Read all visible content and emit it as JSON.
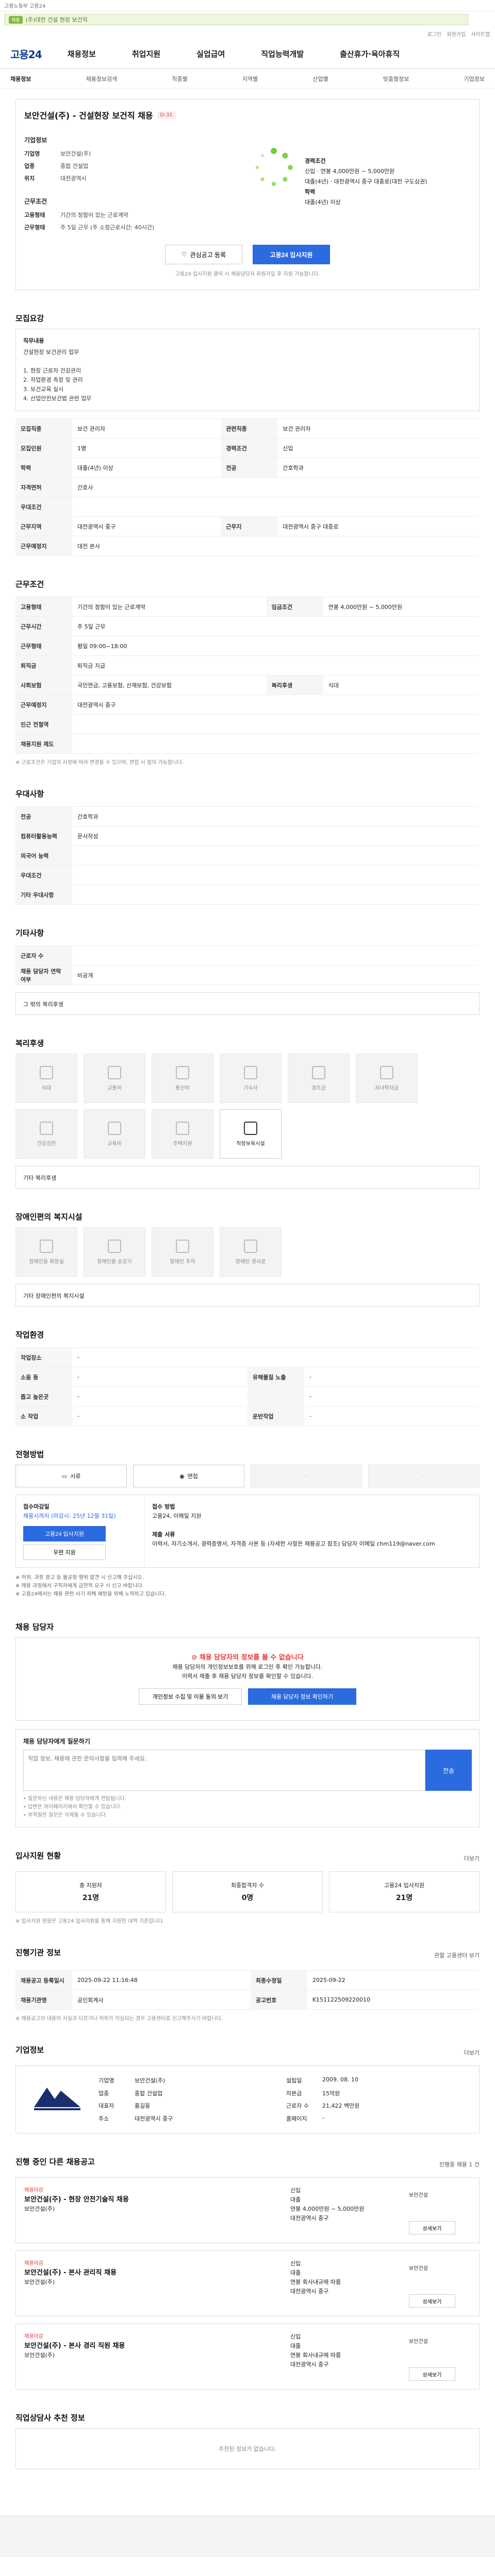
{
  "header": {
    "top_note": "고용노동부 고용24",
    "search_tag": "채용",
    "search_text": "(주)대전 건설 현장 보건직",
    "util_links": [
      "로그인",
      "회원가입",
      "사이트맵"
    ],
    "logo": "고용24",
    "menu": [
      "채용정보",
      "취업지원",
      "실업급여",
      "직업능력개발",
      "출산휴가·육아휴직"
    ]
  },
  "lnb": [
    "채용정보",
    "채용정보검색",
    "직종별",
    "지역별",
    "산업별",
    "맞춤형정보",
    "기업정보"
  ],
  "job": {
    "title": "보안건설(주) - 건설현장 보건직 채용",
    "badge": "D-31",
    "company_header": "기업정보",
    "company_rows": [
      [
        "기업명",
        "보안건설(주)"
      ],
      [
        "업종",
        "종합 건설업"
      ],
      [
        "위치",
        "대전광역시"
      ]
    ],
    "cond_header": "근무조건",
    "cond_rows": [
      [
        "고용형태",
        "기간의 정함이 있는 근로계약"
      ],
      [
        "근무형태",
        "주 5일 근무 (주 소정근로시간: 40시간)"
      ]
    ],
    "salary_header": "경력조건",
    "salary_lines": [
      "신입",
      "연봉 4,000만원 ~ 5,000만원",
      "대졸(4년)",
      "대전광역시 중구 대종로(대전 구도심권)",
      "학력",
      "대졸(4년) 이상"
    ],
    "save_btn": "관심공고 등록",
    "apply_btn": "고용24 입사지원",
    "notice": "고용24 입사지원 클릭 시 채용담당자 회원가입 후 지원 가능합니다."
  },
  "recruit": {
    "title": "모집요강",
    "desc_title": "직무내용",
    "desc": "건설현장 보건관리 업무\n\n1. 현장 근로자 건강관리\n2. 작업환경 측정 및 관리\n3. 보건교육 실시\n4. 산업안전보건법 관련 업무",
    "rows": [
      [
        "모집직종",
        "보건 관리자",
        "관련직종",
        "보건 관리자"
      ],
      [
        "모집인원",
        "1명",
        "경력조건",
        "신입"
      ],
      [
        "학력",
        "대졸(4년) 이상",
        "전공",
        "간호학과"
      ],
      [
        "자격면허",
        "간호사",
        "",
        ""
      ],
      [
        "우대조건",
        "",
        ""
      ],
      [
        "근무지역",
        "대전광역시 중구",
        "근무지",
        "대전광역시 중구 대종로"
      ],
      [
        "근무예정지",
        "대전 본사",
        "",
        ""
      ]
    ]
  },
  "conditions": {
    "title": "근무조건",
    "rows": [
      [
        "고용형태",
        "기간의 정함이 있는 근로계약",
        "임금조건",
        "연봉 4,000만원 ~ 5,000만원"
      ],
      [
        "근무시간",
        "주 5일 근무",
        "",
        ""
      ],
      [
        "근무형태",
        "평일 09:00~18:00",
        "",
        ""
      ],
      [
        "퇴직금",
        "퇴직금 지급",
        "",
        ""
      ],
      [
        "사회보험",
        "국민연금, 고용보험, 산재보험, 건강보험",
        "복리후생",
        "식대"
      ],
      [
        "근무예정지",
        "대전광역시 중구",
        "",
        ""
      ],
      [
        "인근 전철역",
        "",
        ""
      ],
      [
        "채용지원 제도",
        "",
        ""
      ]
    ],
    "hint": "※ 근로조건은 기업의 사정에 따라 변경될 수 있으며, 면접 시 협의 가능합니다."
  },
  "extras": {
    "title": "우대사항",
    "rows": [
      [
        "전공",
        "간호학과"
      ],
      [
        "컴퓨터활용능력",
        "",
        "문서작성"
      ],
      [
        "외국어 능력",
        ""
      ],
      [
        "우대조건",
        ""
      ],
      [
        "기타 우대사항",
        ""
      ]
    ]
  },
  "other": {
    "title": "기타사항",
    "rows": [
      [
        "근로자 수",
        "",
        "",
        ""
      ],
      [
        "채용 담당자 연락 여부",
        "비공개"
      ]
    ],
    "etc_label": "그 밖의 복리후생"
  },
  "welfare": {
    "title": "복리후생",
    "items": [
      "식대",
      "교통비",
      "통신비",
      "기숙사",
      "경조금",
      "자녀학자금",
      "건강검진",
      "교육비",
      "주택지원",
      "직장보육시설"
    ],
    "active_index": 9,
    "other": "기타 복리후생"
  },
  "disabled": {
    "title": "장애인편의 복지시설",
    "items": [
      "장애인용 화장실",
      "장애인용 승강기",
      "장애인 주차",
      "장애인 경사로"
    ],
    "other": "기타 장애인편의 복지시설"
  },
  "env": {
    "title": "작업환경",
    "rows": [
      [
        "작업장소",
        "-",
        "",
        ""
      ],
      [
        "소음 등",
        "-",
        "유해물질 노출",
        "-"
      ],
      [
        "좁고 높은곳",
        "-",
        "",
        "-"
      ],
      [
        "소 작업",
        "-",
        "운반작업",
        "-"
      ]
    ]
  },
  "process": {
    "title": "전형방법",
    "steps": [
      "서류",
      "면접",
      "-",
      "-"
    ],
    "apply_title": "접수마감일",
    "apply_date": "채용시까지 (마감시: 25년 12월 31일)",
    "apply_btn": "고용24 입사지원",
    "apply_btn2": "우편 지원",
    "method_title": "접수 방법",
    "method_text": "고용24, 이메일 지원",
    "docs_title": "제출 서류",
    "docs_text": "이력서, 자기소개서, 경력증명서, 자격증 사본 등 (자세한 사항은 채용공고 참조) 담당자 이메일 chm119@naver.com",
    "bullets": [
      "※ 허위, 과장 광고 등 불공정 행위 발견 시 신고해 주십시오.",
      "※ 채용 과정에서 구직자에게 금전적 요구 시 신고 바랍니다.",
      "※ 고용24에서는 채용 관련 사기 피해 예방을 위해 노력하고 있습니다."
    ]
  },
  "manager": {
    "title": "채용 담당자",
    "warn": "채용 담당자의 정보를 볼 수 없습니다",
    "text1": "채용 담당자의 개인정보보호를 위해 로그인 후 확인 가능합니다.",
    "text2": "이력서 제출 후 채용 담당자 정보를 확인할 수 있습니다.",
    "btn1": "개인정보 수집 및 이용 동의 보기",
    "btn2": "채용 담당자 정보 확인하기",
    "qa_label": "채용 담당자에게 질문하기",
    "qa_placeholder": "직업 정보, 채용에 관한 문의사항을 입력해 주세요.",
    "qa_send": "전송",
    "qa_notes": [
      "• 질문하신 내용은 채용 담당자에게 전달됩니다.",
      "• 답변은 마이페이지에서 확인할 수 있습니다.",
      "• 부적절한 질문은 삭제될 수 있습니다."
    ]
  },
  "stats": {
    "title": "입사지원 현황",
    "more": "더보기",
    "items": [
      [
        "총 지원자",
        "21명"
      ],
      [
        "최종합격자 수",
        "0명"
      ],
      [
        "고용24 입사지원",
        "21명"
      ]
    ],
    "hint": "※ 입사지원 현황은 고용24 입사지원을 통해 지원한 내역 기준입니다."
  },
  "info": {
    "title": "진행기관 정보",
    "more": "관할 고용센터 보기",
    "rows": [
      [
        "채용공고 등록일시",
        "2025-09-22 11:16:48",
        "최종수정일",
        "2025-09-22"
      ],
      [
        "채용기관명",
        "공인회계사",
        "공고번호",
        "K151122509220010"
      ]
    ],
    "hint": "※ 채용공고의 내용이 사실과 다르거나 허위가 의심되는 경우 고용센터로 신고해주시기 바랍니다."
  },
  "company": {
    "title": "기업정보",
    "more": "더보기",
    "logo": "보안건설",
    "rows1": [
      [
        "기업명",
        "보안건설(주)"
      ],
      [
        "업종",
        "종합 건설업"
      ],
      [
        "대표자",
        "홍길동"
      ],
      [
        "주소",
        "대전광역시 중구"
      ]
    ],
    "rows2": [
      [
        "설립일",
        "2009. 08. 10"
      ],
      [
        "자본금",
        "15억원"
      ],
      [
        "근로자 수",
        "21,422 백만원"
      ],
      [
        "홈페이지",
        "-"
      ]
    ],
    "btn": "기업정보 상세보기"
  },
  "related": {
    "title": "진행 중인 다른 채용공고",
    "more": "진행중 채용 1 건",
    "jobs": [
      {
        "tag": "채용마감",
        "title": "보안건설(주) - 현장 안전기술직 채용",
        "company": "보안건설(주)",
        "c1": "신입",
        "c2": "대졸",
        "c3": "연봉 4,000만원 ~ 5,000만원",
        "c4": "대전광역시 중구",
        "brand": "보안건설",
        "btn": "상세보기"
      },
      {
        "tag": "채용마감",
        "title": "보안건설(주) - 본사 관리직 채용",
        "company": "보안건설(주)",
        "c1": "신입",
        "c2": "대졸",
        "c3": "연봉 회사내규에 따름",
        "c4": "대전광역시 중구",
        "brand": "보안건설",
        "btn": "상세보기"
      },
      {
        "tag": "채용마감",
        "title": "보안건설(주) - 본사 경리 직원 채용",
        "company": "보안건설(주)",
        "c1": "신입",
        "c2": "대졸",
        "c3": "연봉 회사내규에 따름",
        "c4": "대전광역시 중구",
        "brand": "보안건설",
        "btn": "상세보기"
      }
    ]
  },
  "consult": {
    "title": "직업상담사 추천 정보",
    "empty": "추천된 정보가 없습니다."
  }
}
